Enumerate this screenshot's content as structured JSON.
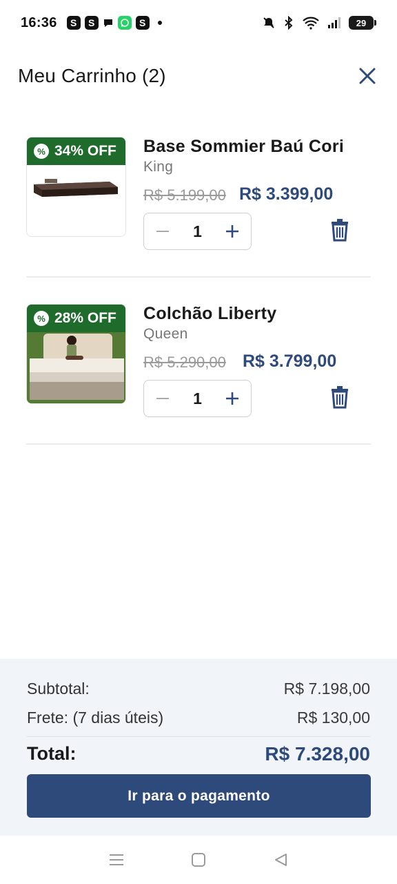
{
  "status_bar": {
    "time": "16:36",
    "notifications": [
      "S",
      "S",
      "chat",
      "whatsapp",
      "S"
    ],
    "battery": "29"
  },
  "header": {
    "title": "Meu Carrinho (2)"
  },
  "cart": {
    "items": [
      {
        "badge": "34% OFF",
        "name": "Base Sommier Baú Cori",
        "variant": "King",
        "old_price": "R$ 5.199,00",
        "new_price": "R$ 3.399,00",
        "quantity": "1"
      },
      {
        "badge": "28% OFF",
        "name": "Colchão Liberty",
        "variant": "Queen",
        "old_price": "R$ 5.290,00",
        "new_price": "R$ 3.799,00",
        "quantity": "1"
      }
    ]
  },
  "summary": {
    "subtotal_label": "Subtotal:",
    "subtotal_value": "R$ 7.198,00",
    "frete_label": "Frete: (7 dias úteis)",
    "frete_value": "R$ 130,00",
    "total_label": "Total:",
    "total_value": "R$ 7.328,00",
    "pay_button": "Ir para o pagamento"
  },
  "colors": {
    "accent": "#2d4a7a",
    "badge_green": "#1f6b2c",
    "summary_bg": "#f1f4f9"
  }
}
